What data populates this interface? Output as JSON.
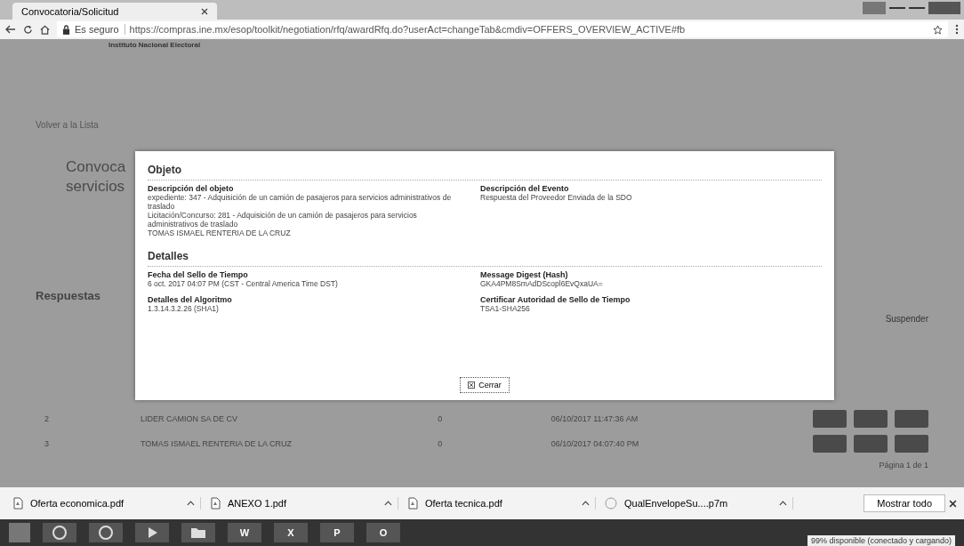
{
  "browser": {
    "tab_title": "Convocatoria/Solicitud",
    "secure_label": "Es seguro",
    "url": "https://compras.ine.mx/esop/toolkit/negotiation/rfq/awardRfq.do?userAct=changeTab&cmdiv=OFFERS_OVERVIEW_ACTIVE#fb"
  },
  "page": {
    "org_name": "Instituto Nacional Electoral",
    "back_link": "Volver a la Lista",
    "title_lines": [
      "Convoca",
      "servicios"
    ],
    "section": "Respuestas",
    "suspend": "Suspender",
    "rows": [
      {
        "number": "2",
        "name": "LIDER CAMION SA DE CV",
        "count": "0",
        "date": "06/10/2017 11:47:36 AM"
      },
      {
        "number": "3",
        "name": "TOMAS ISMAEL RENTERIA DE LA CRUZ",
        "count": "0",
        "date": "06/10/2017 04:07:40 PM"
      }
    ],
    "pagination": "Página 1 de 1"
  },
  "modal": {
    "sections": [
      {
        "title": "Objeto",
        "fields": [
          {
            "label": "Descripción del objeto",
            "lines": [
              "expediente:  347 - Adquisición de un camión de pasajeros para servicios administrativos de traslado",
              "Licitación/Concurso:  281 - Adquisición de un camión de pasajeros para servicios administrativos de traslado",
              "TOMAS ISMAEL RENTERIA DE LA CRUZ"
            ]
          },
          {
            "label": "Descripción del Evento",
            "lines": [
              "Respuesta del Proveedor Enviada de la SDO"
            ]
          }
        ]
      },
      {
        "title": "Detalles",
        "fields": [
          {
            "label": "Fecha del Sello de Tiempo",
            "lines": [
              "6 oct. 2017 04:07 PM (CST - Central America Time DST)"
            ]
          },
          {
            "label": "Message Digest (Hash)",
            "lines": [
              "GKA4PM8SmAdDScopl6EvQxaUA="
            ]
          },
          {
            "label": "Detalles del Algoritmo",
            "lines": [
              "1.3.14.3.2.26 (SHA1)"
            ]
          },
          {
            "label": "Certificar Autoridad de Sello de Tiempo",
            "lines": [
              "TSA1-SHA256"
            ]
          }
        ]
      }
    ],
    "close_button": "Cerrar"
  },
  "downloads": {
    "items": [
      {
        "name": "Oferta economica.pdf",
        "kind": "pdf"
      },
      {
        "name": "ANEXO 1.pdf",
        "kind": "pdf"
      },
      {
        "name": "Oferta tecnica.pdf",
        "kind": "pdf"
      },
      {
        "name": "QualEnvelopeSu....p7m",
        "kind": "file"
      }
    ],
    "show_all": "Mostrar todo"
  },
  "taskbar": {
    "apps": [
      {
        "kind": "browser"
      },
      {
        "kind": "browser"
      },
      {
        "kind": "media"
      },
      {
        "kind": "folder"
      },
      {
        "kind": "office",
        "label": "W"
      },
      {
        "kind": "office",
        "label": "X"
      },
      {
        "kind": "office",
        "label": "P"
      },
      {
        "kind": "office",
        "label": "O"
      }
    ],
    "battery_status": "99% disponible (conectado y cargando)"
  }
}
